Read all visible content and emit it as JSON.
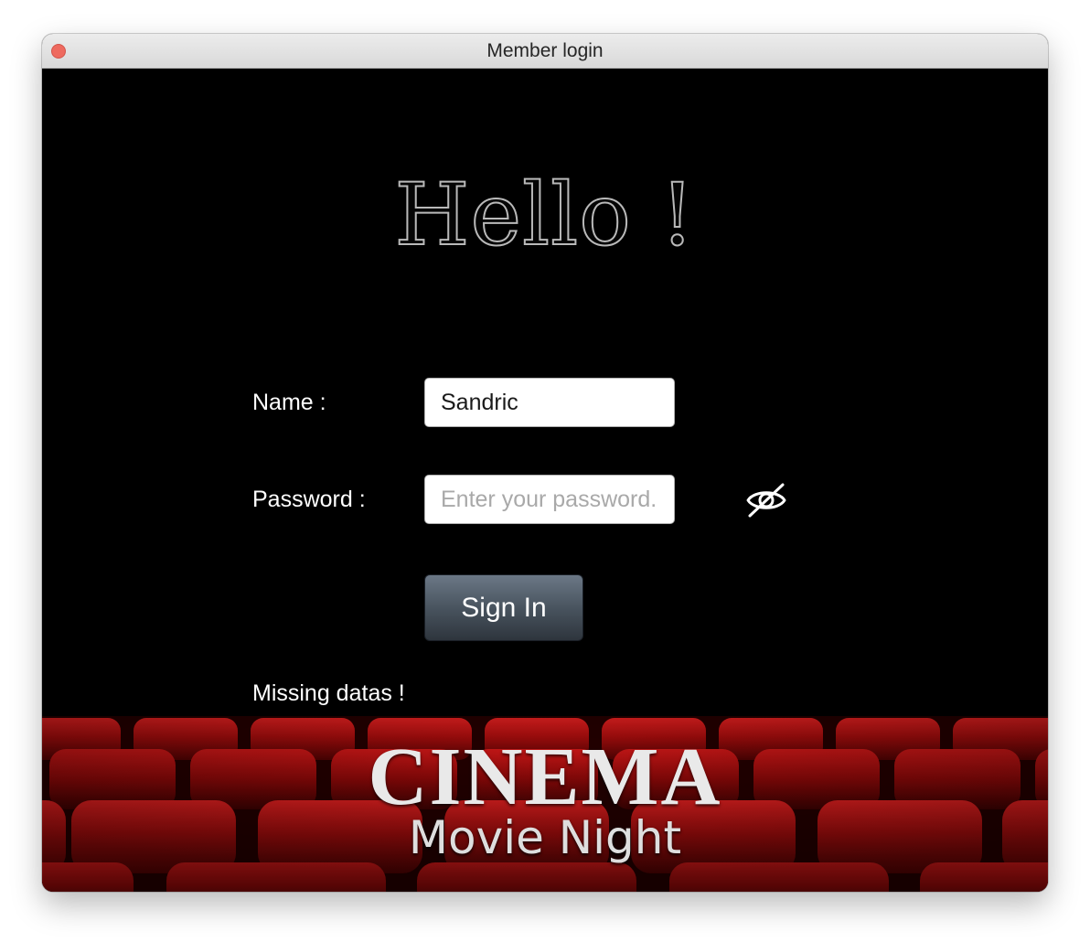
{
  "window": {
    "title": "Member login"
  },
  "greeting": "Hello !",
  "form": {
    "name_label": "Name :",
    "name_value": "Sandric",
    "password_label": "Password :",
    "password_placeholder": "Enter your password.",
    "password_value": "",
    "visibility_icon": "eye-slash-icon",
    "signin_label": "Sign In",
    "status_message": "Missing datas !"
  },
  "banner": {
    "title": "CINEMA",
    "subtitle": "Movie Night"
  },
  "colors": {
    "background": "#000000",
    "seats": "#8b0a0a",
    "close_button": "#ee6a5f",
    "button": "#49545f"
  }
}
